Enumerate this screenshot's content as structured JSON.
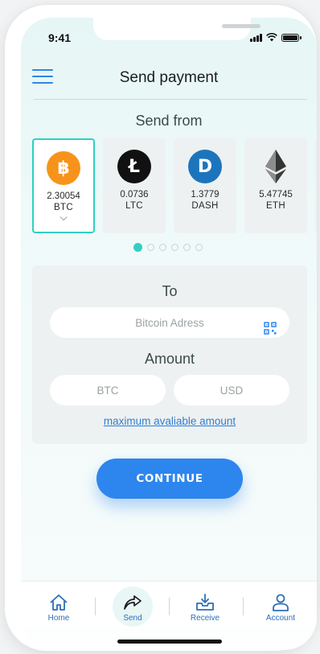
{
  "status": {
    "time": "9:41"
  },
  "header": {
    "title": "Send payment"
  },
  "send_from": {
    "label": "Send from",
    "coins": [
      {
        "symbol": "BTC",
        "amount": "2.30054",
        "icon": "bitcoin-icon",
        "glyph": "฿",
        "color": "#f7931a",
        "selected": true
      },
      {
        "symbol": "LTC",
        "amount": "0.0736",
        "icon": "litecoin-icon",
        "glyph": "Ł",
        "color": "#111111",
        "selected": false
      },
      {
        "symbol": "DASH",
        "amount": "1.3779",
        "icon": "dash-icon",
        "glyph": "D",
        "color": "#1c75bc",
        "selected": false
      },
      {
        "symbol": "ETH",
        "amount": "5.47745",
        "icon": "ethereum-icon",
        "glyph": "◆",
        "color": "#3c3c3d",
        "selected": false
      }
    ],
    "pager": {
      "total": 6,
      "active": 0
    }
  },
  "to": {
    "label": "To",
    "address_placeholder": "Bitcoin Adress",
    "icon": "qr-code-icon"
  },
  "amount": {
    "label": "Amount",
    "btc_placeholder": "BTC",
    "usd_placeholder": "USD",
    "max_link": "maximum avaliable amount"
  },
  "actions": {
    "continue_label": "CONTINUE"
  },
  "tabbar": {
    "items": [
      {
        "label": "Home",
        "icon": "home-icon",
        "active": false
      },
      {
        "label": "Send",
        "icon": "send-icon",
        "active": true
      },
      {
        "label": "Receive",
        "icon": "receive-icon",
        "active": false
      },
      {
        "label": "Account",
        "icon": "account-icon",
        "active": false
      }
    ]
  },
  "colors": {
    "accent": "#2d86ee",
    "teal": "#2fd0c3",
    "tab_label": "#2c6fb9"
  }
}
